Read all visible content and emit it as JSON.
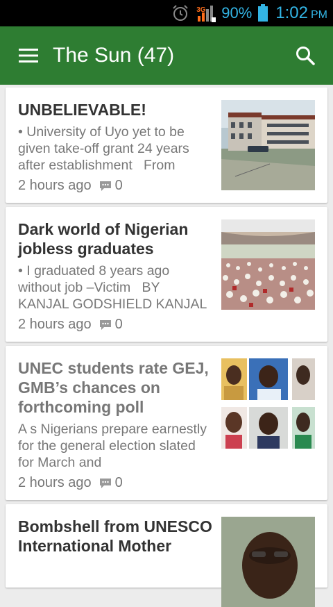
{
  "status_bar": {
    "network": "3G",
    "battery": "90%",
    "time": "1:02",
    "ampm": "PM",
    "icons": [
      "alarm-icon",
      "signal-icon",
      "battery-icon"
    ],
    "accent": "#33b5e5"
  },
  "app_bar": {
    "title": "The Sun (47)",
    "color": "#2e7d32",
    "icons": [
      "menu-icon",
      "search-icon"
    ]
  },
  "articles": [
    {
      "headline": "UNBELIEVABLE!",
      "excerpt": "• University of Uyo yet to be given take-off grant 24 years after establishment   From",
      "time": "2 hours ago",
      "comments": "0",
      "thumb": "campus-building-photo"
    },
    {
      "headline": "Dark world of Nigerian jobless graduates",
      "excerpt": "• I graduated 8 years ago without job –Victim   BY KANJAL GODSHIELD KANJAL",
      "time": "2 hours ago",
      "comments": "0",
      "thumb": "stadium-crowd-photo"
    },
    {
      "headline": "UNEC students rate GEJ, GMB’s chances on forthcoming poll",
      "excerpt": "A s Nigerians prepare earnestly for the general election slated for March and",
      "time": "2 hours ago",
      "comments": "0",
      "thumb": "student-portraits-photo",
      "read": true
    },
    {
      "headline": "Bombshell from UNESCO International Mother",
      "thumb": "man-portrait-photo"
    }
  ]
}
